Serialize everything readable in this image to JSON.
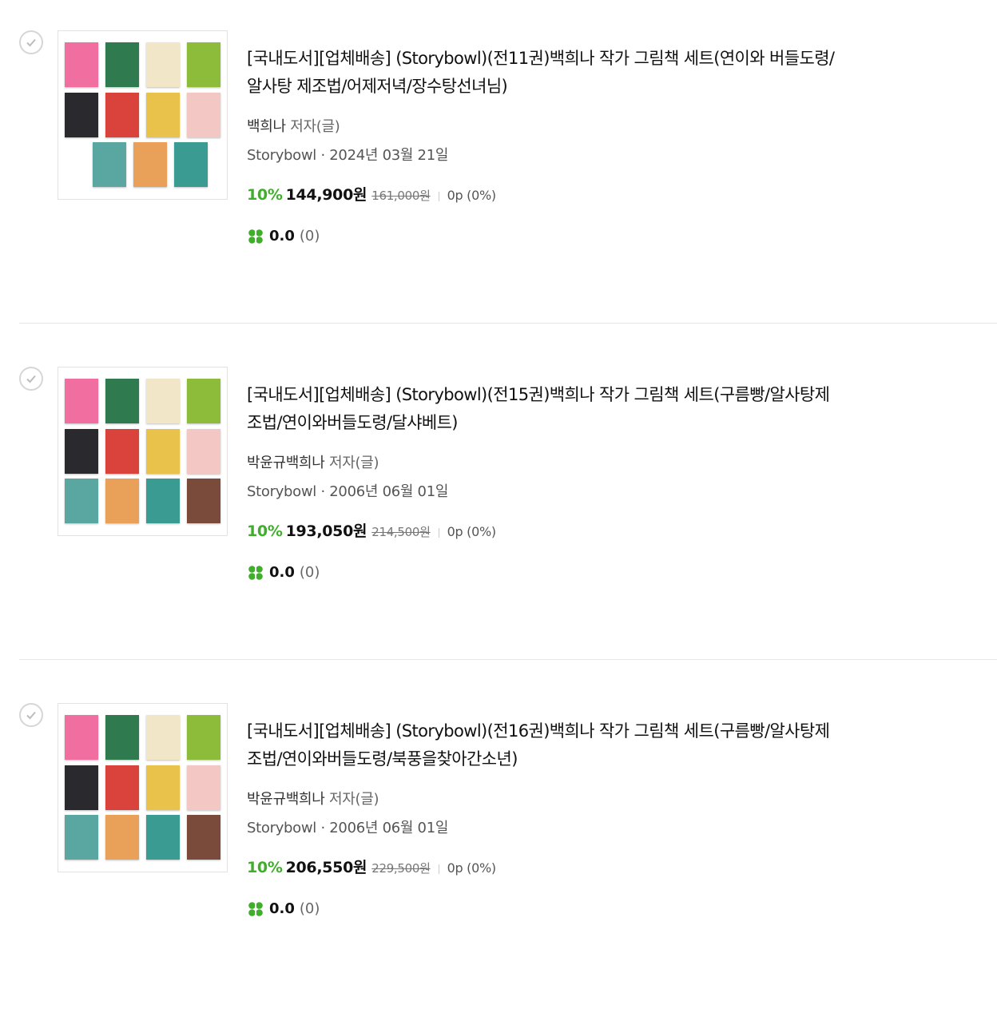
{
  "colors": {
    "discount": "#3fae2a",
    "divider": "#e6e6e6"
  },
  "icons": {
    "select": "check-circle-icon",
    "review": "clover-icon"
  },
  "products": [
    {
      "title": "[국내도서][업체배송] (Storybowl)(전11권)백희나 작가 그림책 세트(연이와 버들도령/알사탕 제조법/어제저녁/장수탕선녀님)",
      "author": "백희나",
      "author_role": "저자(글)",
      "publisher": "Storybowl",
      "date": "2024년 03월 21일",
      "discount_rate": "10%",
      "price": "144,900원",
      "original_price": "161,000원",
      "points": "0p (0%)",
      "rating": "0.0",
      "review_count": "(0)",
      "cover_count": 11
    },
    {
      "title": "[국내도서][업체배송] (Storybowl)(전15권)백희나 작가 그림책 세트(구름빵/알사탕제조법/연이와버들도령/달샤베트)",
      "author": "박윤규백희나",
      "author_role": "저자(글)",
      "publisher": "Storybowl",
      "date": "2006년 06월 01일",
      "discount_rate": "10%",
      "price": "193,050원",
      "original_price": "214,500원",
      "points": "0p (0%)",
      "rating": "0.0",
      "review_count": "(0)",
      "cover_count": 12
    },
    {
      "title": "[국내도서][업체배송] (Storybowl)(전16권)백희나 작가 그림책 세트(구름빵/알사탕제조법/연이와버들도령/북풍을찾아간소년)",
      "author": "박윤규백희나",
      "author_role": "저자(글)",
      "publisher": "Storybowl",
      "date": "2006년 06월 01일",
      "discount_rate": "10%",
      "price": "206,550원",
      "original_price": "229,500원",
      "points": "0p (0%)",
      "rating": "0.0",
      "review_count": "(0)",
      "cover_count": 12
    }
  ]
}
